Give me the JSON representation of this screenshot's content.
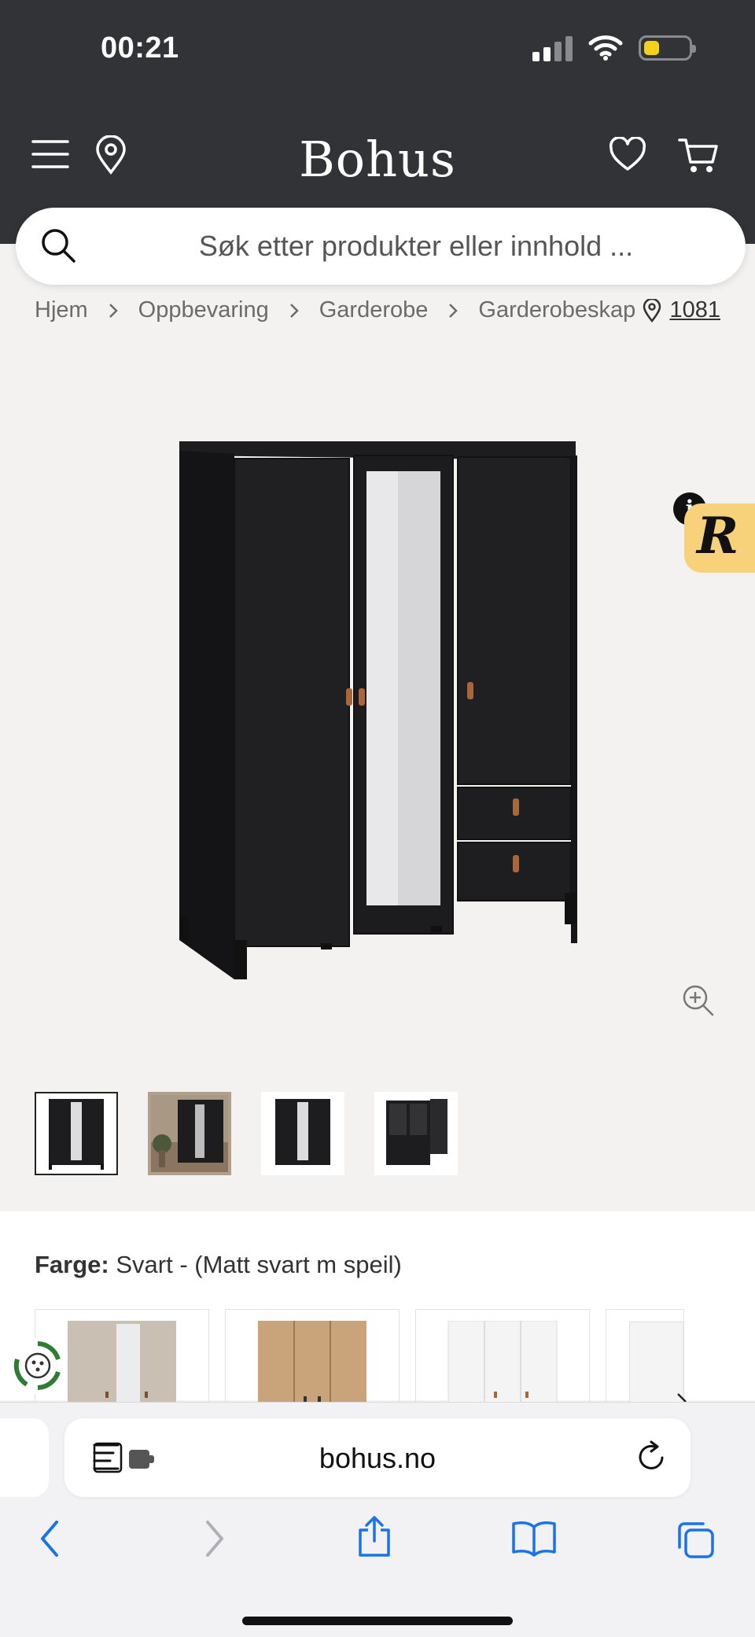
{
  "status_bar": {
    "time": "00:21"
  },
  "header": {
    "logo": "Bohus"
  },
  "search": {
    "placeholder": "Søk etter produkter eller innhold ..."
  },
  "breadcrumb": {
    "items": [
      "Hjem",
      "Oppbevaring",
      "Garderobe",
      "Garderobeskap"
    ],
    "store": "1081"
  },
  "gallery": {
    "thumbnail_count": 4,
    "active_index": 0
  },
  "color": {
    "label": "Farge:",
    "value": "Svart - (Matt svart m speil)"
  },
  "browser": {
    "url": "bohus.no"
  },
  "colors": {
    "header_bg": "#323336",
    "badge_yellow": "#f7d27a",
    "link_blue": "#1a73e8",
    "eco_green": "#2e7d32"
  }
}
